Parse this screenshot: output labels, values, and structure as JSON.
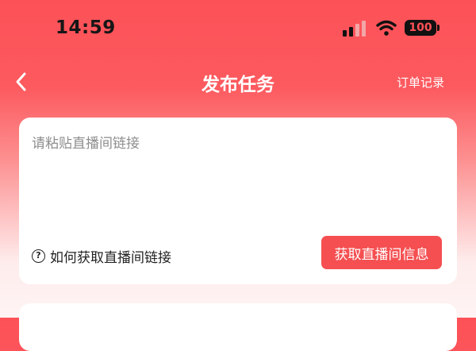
{
  "status_bar": {
    "time": "14:59",
    "battery": "100"
  },
  "nav": {
    "back_icon": "chevron-left-icon",
    "title": "发布任务",
    "orders_link": "订单记录"
  },
  "link_card": {
    "input_placeholder": "请粘贴直播间链接",
    "input_value": "",
    "help_icon": "question-circle-icon",
    "help_text": "如何获取直播间链接",
    "fetch_button": "获取直播间信息"
  },
  "colors": {
    "accent": "#fc5157",
    "button": "#f54f51",
    "card": "#ffffff"
  }
}
